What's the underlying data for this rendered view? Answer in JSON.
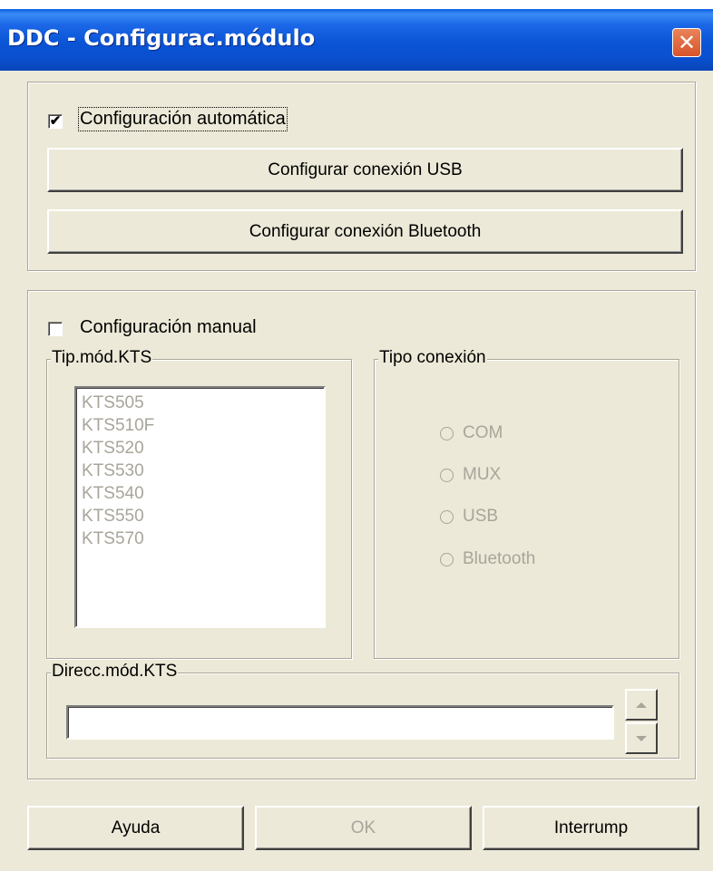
{
  "window": {
    "title": "DDC - Configurac.módulo",
    "close_glyph": "✕"
  },
  "auto": {
    "checkbox_label": "Configuración automática",
    "checked": true,
    "check_glyph": "✔",
    "usb_button": "Configurar conexión USB",
    "bluetooth_button": "Configurar conexión Bluetooth"
  },
  "manual": {
    "checkbox_label": "Configuración manual",
    "checked": false,
    "module_type_legend": "Tip.mód.KTS",
    "module_types": [
      "KTS505",
      "KTS510F",
      "KTS520",
      "KTS530",
      "KTS540",
      "KTS550",
      "KTS570"
    ],
    "connection_legend": "Tipo conexión",
    "connections": [
      "COM",
      "MUX",
      "USB",
      "Bluetooth"
    ],
    "address_legend": "Direcc.mód.KTS",
    "address_value": ""
  },
  "footer": {
    "help": "Ayuda",
    "ok": "OK",
    "cancel": "Interrump"
  },
  "colors": {
    "disabled_text": "#a8a59a",
    "face": "#ece9d8",
    "titlebar": "#0a54d6"
  }
}
